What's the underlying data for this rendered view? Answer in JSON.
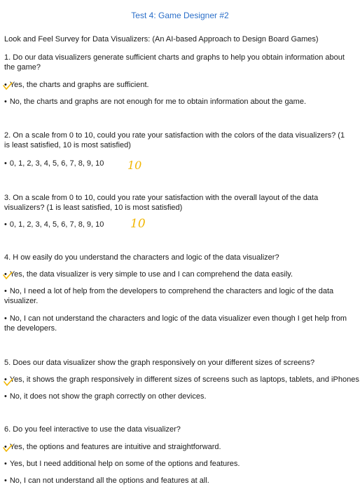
{
  "title": "Test 4: Game Designer #2",
  "survey_title": "Look and Feel Survey for Data Visualizers: (An AI-based Approach to Design Board Games)",
  "q1": {
    "question": "1. Do our data visualizers generate sufficient charts and graphs to help you obtain information about the game?",
    "options": [
      "Yes, the charts and graphs are sufficient.",
      "No, the charts and graphs are not enough for me to obtain information about the game."
    ]
  },
  "q2": {
    "question": "2. On a scale from 0 to 10, could you rate your satisfaction with the colors of the data visualizers? (1 is least satisfied, 10 is most satisfied)",
    "options": [
      "0, 1, 2, 3, 4, 5, 6, 7, 8, 9, 10"
    ],
    "answer": "10"
  },
  "q3": {
    "question": "3. On a scale from 0 to 10, could you rate your satisfaction with the overall layout of the data visualizers? (1 is least satisfied, 10 is most satisfied)",
    "options": [
      "0, 1, 2, 3, 4, 5, 6, 7, 8, 9, 10"
    ],
    "answer": "10"
  },
  "q4": {
    "question": "4. H ow easily do you understand the characters and logic of the data visualizer?",
    "options": [
      "Yes, the data visualizer is very simple to use and I can comprehend the data easily.",
      "No, I need a lot of help from the developers to comprehend the characters and logic of the data visualizer.",
      "No, I can not understand the characters and logic of the data visualizer even though I get help from the developers."
    ]
  },
  "q5": {
    "question": "5. Does our data visualizer show the graph responsively on your different sizes of screens?",
    "options": [
      "Yes, it shows the graph responsively in different sizes of screens such as laptops, tablets, and iPhones.",
      "No, it does not show the graph correctly on other devices."
    ]
  },
  "q6": {
    "question": "6. Do you feel interactive to use the data visualizer?",
    "options": [
      "Yes, the options and features are intuitive and straightforward.",
      "Yes, but I need additional help on some of the options and features.",
      "No, I can not understand all the options and features at all."
    ]
  },
  "colors": {
    "title": "#2b6fc9",
    "handwriting": "#f2b705"
  }
}
